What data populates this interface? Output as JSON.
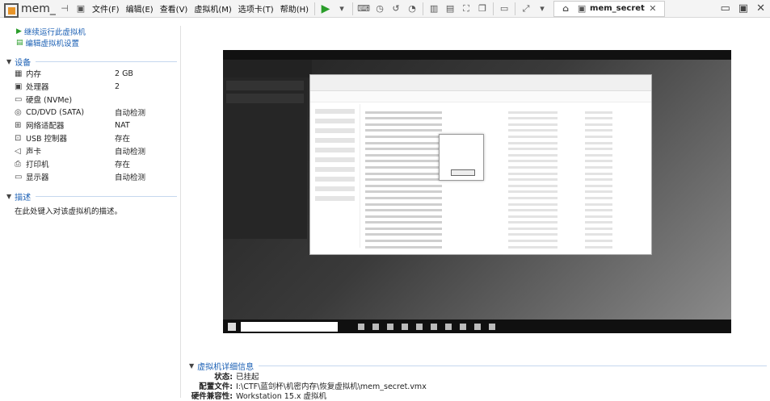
{
  "app": {
    "title": "mem_",
    "tab_label": "mem_secret"
  },
  "menu": [
    "文件(F)",
    "编辑(E)",
    "查看(V)",
    "虚拟机(M)",
    "选项卡(T)",
    "帮助(H)"
  ],
  "actions": [
    {
      "label": "继续运行此虚拟机",
      "icon": "play-icon"
    },
    {
      "label": "编辑虚拟机设置",
      "icon": "settings-icon"
    }
  ],
  "devices_section": {
    "title": "设备"
  },
  "devices": [
    {
      "icon": "memory-icon",
      "name": "内存",
      "value": "2 GB"
    },
    {
      "icon": "cpu-icon",
      "name": "处理器",
      "value": "2"
    },
    {
      "icon": "disk-icon",
      "name": "硬盘 (NVMe)",
      "value": ""
    },
    {
      "icon": "cd-icon",
      "name": "CD/DVD (SATA)",
      "value": "自动检测"
    },
    {
      "icon": "network-icon",
      "name": "网络适配器",
      "value": "NAT"
    },
    {
      "icon": "usb-icon",
      "name": "USB 控制器",
      "value": "存在"
    },
    {
      "icon": "sound-icon",
      "name": "声卡",
      "value": "自动检测"
    },
    {
      "icon": "printer-icon",
      "name": "打印机",
      "value": "存在"
    },
    {
      "icon": "display-icon",
      "name": "显示器",
      "value": "自动检测"
    }
  ],
  "description": {
    "title": "描述",
    "text": "在此处键入对该虚拟机的描述。"
  },
  "details": {
    "title": "虚拟机详细信息",
    "status_label": "状态:",
    "status_value": "已挂起",
    "config_label": "配置文件:",
    "config_value": "I:\\CTF\\蓝剑杯\\机密内存\\恢复虚拟机\\mem_secret.vmx",
    "compat_label": "硬件兼容性:",
    "compat_value": "Workstation 15.x 虚拟机"
  },
  "colors": {
    "accent": "#1a5fb4",
    "play": "#2a9d2a"
  }
}
